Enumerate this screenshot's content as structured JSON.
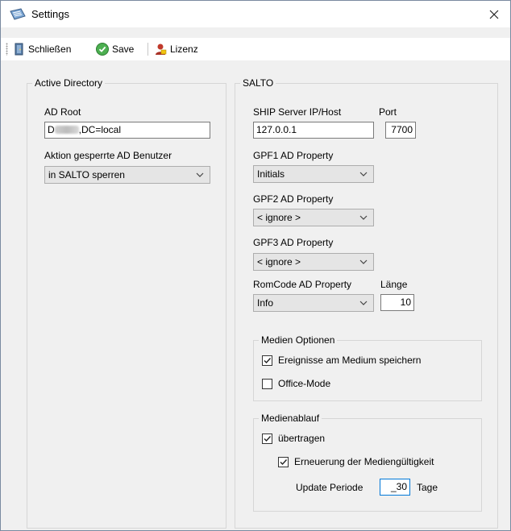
{
  "window": {
    "title": "Settings"
  },
  "toolbar": {
    "close_label": "Schließen",
    "save_label": "Save",
    "license_label": "Lizenz"
  },
  "ad": {
    "group_title": "Active Directory",
    "root_label": "AD Root",
    "root_value_start": "D",
    "root_value_end": ",DC=local",
    "action_label": "Aktion gesperrte AD Benutzer",
    "action_value": "in SALTO sperren"
  },
  "salto": {
    "group_title": "SALTO",
    "ship_label": "SHIP Server IP/Host",
    "ship_value": "127.0.0.1",
    "port_label": "Port",
    "port_value": "7700",
    "gpf1_label": "GPF1 AD Property",
    "gpf1_value": "Initials",
    "gpf2_label": "GPF2 AD Property",
    "gpf2_value": "< ignore >",
    "gpf3_label": "GPF3 AD Property",
    "gpf3_value": "< ignore >",
    "romcode_label": "RomCode AD Property",
    "romcode_value": "Info",
    "length_label": "Länge",
    "length_value": "10"
  },
  "media_options": {
    "group_title": "Medien Optionen",
    "store_events_label": "Ereignisse am Medium speichern",
    "store_events_checked": true,
    "office_mode_label": "Office-Mode",
    "office_mode_checked": false
  },
  "media_expiry": {
    "group_title": "Medienablauf",
    "transfer_label": "übertragen",
    "transfer_checked": true,
    "renewal_label": "Erneuerung der Mediengültigkeit",
    "renewal_checked": true,
    "period_label": "Update Periode",
    "period_value": "_30",
    "days_label": "Tage"
  }
}
